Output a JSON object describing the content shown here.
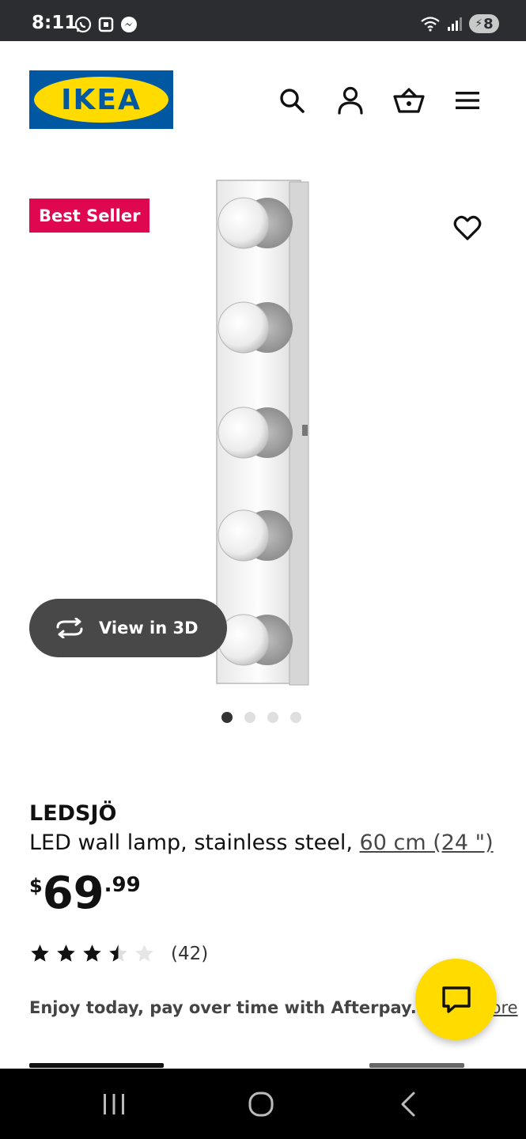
{
  "status_bar": {
    "time": "8:11",
    "battery": "8",
    "left_icons": [
      "whatsapp-icon",
      "calendar-icon",
      "messenger-icon"
    ],
    "right_icons": [
      "wifi-icon",
      "signal-icon",
      "battery-charging-icon"
    ]
  },
  "header": {
    "logo_text": "IKEA",
    "icons": [
      "search-icon",
      "user-icon",
      "cart-icon",
      "menu-icon"
    ]
  },
  "product_image": {
    "badge": "Best Seller",
    "view_3d_label": "View in 3D",
    "gallery_count": 4,
    "active_index": 0
  },
  "product": {
    "name": "LEDSJÖ",
    "description": "LED wall lamp, stainless steel, ",
    "size_link": "60 cm (24 \")",
    "price_currency": "$",
    "price_integer": "69",
    "price_decimal": ".99",
    "rating": 3.5,
    "rating_max": 5,
    "review_count": "(42)",
    "afterpay_text": "Enjoy today, pay over time with Afterpay.",
    "afterpay_link": "Learn more"
  },
  "colors": {
    "ikea_blue": "#0058a3",
    "ikea_yellow": "#ffdb00",
    "badge_red": "#e00751"
  },
  "nav_bar": {
    "buttons": [
      "recent-apps-icon",
      "home-icon",
      "back-icon"
    ]
  }
}
